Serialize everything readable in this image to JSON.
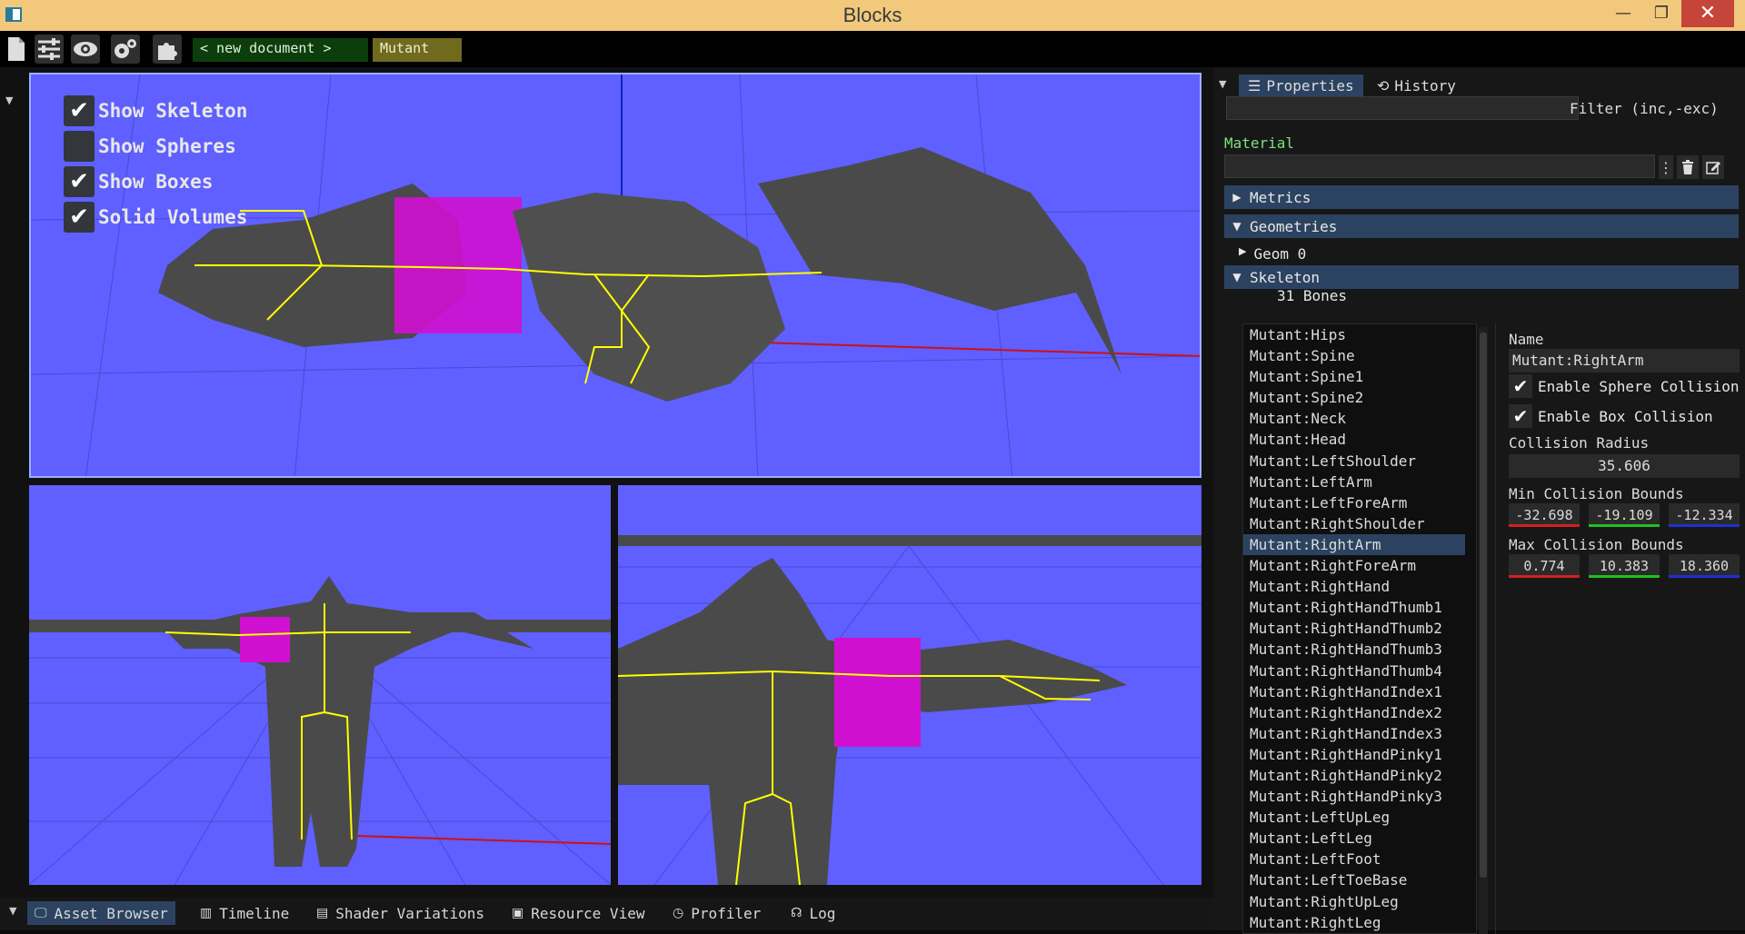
{
  "window": {
    "title": "Blocks",
    "minimize": "—",
    "maximize": "❐",
    "close": "✕"
  },
  "toolbar": {
    "icons": [
      "new-document-icon",
      "sliders-icon",
      "eye-icon",
      "gears-icon",
      "puzzle-icon"
    ],
    "doc_tabs": [
      "< new document >",
      "Mutant"
    ]
  },
  "viewport": {
    "options": [
      {
        "label": "Show Skeleton",
        "checked": true,
        "mark": "✔"
      },
      {
        "label": "Show Spheres",
        "checked": false,
        "mark": ""
      },
      {
        "label": "Show Boxes",
        "checked": true,
        "mark": "✔"
      },
      {
        "label": "Solid Volumes",
        "checked": true,
        "mark": "✔"
      }
    ]
  },
  "bottom_tabs": [
    {
      "label": "Asset Browser",
      "icon": "🖵",
      "active": true
    },
    {
      "label": "Timeline",
      "icon": "▥",
      "active": false
    },
    {
      "label": "Shader Variations",
      "icon": "▤",
      "active": false
    },
    {
      "label": "Resource View",
      "icon": "▣",
      "active": false
    },
    {
      "label": "Profiler",
      "icon": "◷",
      "active": false
    },
    {
      "label": "Log",
      "icon": "☊",
      "active": false
    }
  ],
  "panel": {
    "tabs": [
      {
        "label": "Properties",
        "icon": "☰"
      },
      {
        "label": "History",
        "icon": "⟲"
      }
    ],
    "filter_label": "Filter (inc,-exc)",
    "material_label": "Material",
    "sections": {
      "metrics": "Metrics",
      "geometries": "Geometries",
      "geom0": "Geom 0",
      "skeleton": "Skeleton"
    },
    "bone_count": "31 Bones",
    "bones": [
      "Mutant:Hips",
      "Mutant:Spine",
      "Mutant:Spine1",
      "Mutant:Spine2",
      "Mutant:Neck",
      "Mutant:Head",
      "Mutant:LeftShoulder",
      "Mutant:LeftArm",
      "Mutant:LeftForeArm",
      "Mutant:RightShoulder",
      "Mutant:RightArm",
      "Mutant:RightForeArm",
      "Mutant:RightHand",
      "Mutant:RightHandThumb1",
      "Mutant:RightHandThumb2",
      "Mutant:RightHandThumb3",
      "Mutant:RightHandThumb4",
      "Mutant:RightHandIndex1",
      "Mutant:RightHandIndex2",
      "Mutant:RightHandIndex3",
      "Mutant:RightHandPinky1",
      "Mutant:RightHandPinky2",
      "Mutant:RightHandPinky3",
      "Mutant:LeftUpLeg",
      "Mutant:LeftLeg",
      "Mutant:LeftFoot",
      "Mutant:LeftToeBase",
      "Mutant:RightUpLeg",
      "Mutant:RightLeg"
    ],
    "selected_bone": "Mutant:RightArm",
    "detail": {
      "name_label": "Name",
      "name_value": "Mutant:RightArm",
      "sphere_collision": "Enable Sphere Collision",
      "box_collision": "Enable Box Collision",
      "radius_label": "Collision Radius",
      "radius_value": "35.606",
      "min_label": "Min Collision Bounds",
      "min": [
        "-32.698",
        "-19.109",
        "-12.334"
      ],
      "max_label": "Max Collision Bounds",
      "max": [
        "0.774",
        "10.383",
        "18.360"
      ]
    }
  },
  "colors": {
    "viewport_bg": "#5f60ff",
    "accent": "#2b4360",
    "volume": "#d010d0",
    "bone": "#ffff00"
  }
}
